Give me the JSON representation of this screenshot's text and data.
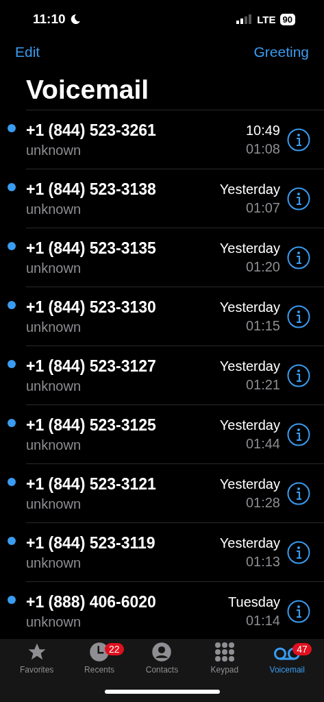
{
  "status_bar": {
    "time": "11:10",
    "network": "LTE",
    "battery": "90"
  },
  "nav": {
    "left": "Edit",
    "right": "Greeting"
  },
  "title": "Voicemail",
  "messages": [
    {
      "caller": "+1 (844) 523-3261",
      "label": "unknown",
      "when": "10:49",
      "duration": "01:08",
      "unread": true
    },
    {
      "caller": "+1 (844) 523-3138",
      "label": "unknown",
      "when": "Yesterday",
      "duration": "01:07",
      "unread": true
    },
    {
      "caller": "+1 (844) 523-3135",
      "label": "unknown",
      "when": "Yesterday",
      "duration": "01:20",
      "unread": true
    },
    {
      "caller": "+1 (844) 523-3130",
      "label": "unknown",
      "when": "Yesterday",
      "duration": "01:15",
      "unread": true
    },
    {
      "caller": "+1 (844) 523-3127",
      "label": "unknown",
      "when": "Yesterday",
      "duration": "01:21",
      "unread": true
    },
    {
      "caller": "+1 (844) 523-3125",
      "label": "unknown",
      "when": "Yesterday",
      "duration": "01:44",
      "unread": true
    },
    {
      "caller": "+1 (844) 523-3121",
      "label": "unknown",
      "when": "Yesterday",
      "duration": "01:28",
      "unread": true
    },
    {
      "caller": "+1 (844) 523-3119",
      "label": "unknown",
      "when": "Yesterday",
      "duration": "01:13",
      "unread": true
    },
    {
      "caller": "+1 (888) 406-6020",
      "label": "unknown",
      "when": "Tuesday",
      "duration": "01:14",
      "unread": true
    }
  ],
  "tab_bar": [
    {
      "kind": "favorites",
      "label": "Favorites",
      "selected": false
    },
    {
      "kind": "recents",
      "label": "Recents",
      "badge": "22",
      "selected": false
    },
    {
      "kind": "contacts",
      "label": "Contacts",
      "selected": false
    },
    {
      "kind": "keypad",
      "label": "Keypad",
      "selected": false
    },
    {
      "kind": "voicemail",
      "label": "Voicemail",
      "badge": "47",
      "selected": true
    }
  ]
}
